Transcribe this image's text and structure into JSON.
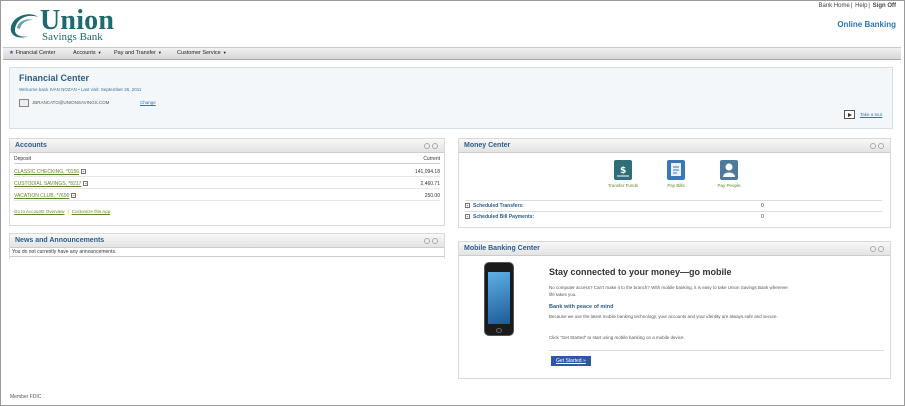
{
  "header": {
    "logo_main": "Union",
    "logo_sub": "Savings Bank",
    "top_links": [
      "Bank Home",
      "Help",
      "Sign Off"
    ],
    "online_banking": "Online Banking"
  },
  "nav": [
    {
      "label": "Financial Center",
      "caret": false
    },
    {
      "label": "Accounts",
      "caret": true
    },
    {
      "label": "Pay and Transfer",
      "caret": true
    },
    {
      "label": "Customer Service",
      "caret": true
    }
  ],
  "financial_center": {
    "title": "Financial Center",
    "welcome": "Welcome back IVAN NOZAN  •  Last visit: September 26, 2011",
    "email": "JBRANCATO@UNIONSAVINGS.COM",
    "change": "Change",
    "tour": "Take a tour"
  },
  "accounts": {
    "title": "Accounts",
    "col_left": "Deposit",
    "col_right": "Current",
    "rows": [
      {
        "name": "CLASSIC CHECKING, *0156",
        "balance": "141,094.18"
      },
      {
        "name": "CUSTODIAL SAVINGS, *8217",
        "balance": "2,460.71"
      },
      {
        "name": "VACATION CLUB, *7690",
        "balance": "250.00"
      }
    ],
    "link_overview": "Go to Accounts Overview",
    "link_customize": "Customize this App"
  },
  "news": {
    "title": "News and Announcements",
    "message": "You do not currently have any announcements."
  },
  "money_center": {
    "title": "Money Center",
    "tiles": [
      {
        "label": "Transfer Funds",
        "icon": "transfer-funds-icon",
        "color": "#2f6e78"
      },
      {
        "label": "Pay Bills",
        "icon": "pay-bills-icon",
        "color": "#3a78b5"
      },
      {
        "label": "Pay People",
        "icon": "pay-people-icon",
        "color": "#4d7a9b"
      }
    ],
    "scheduled_transfers_label": "Scheduled Transfers:",
    "scheduled_transfers_value": "0",
    "scheduled_bill_label": "Scheduled Bill Payments:",
    "scheduled_bill_value": "0"
  },
  "mobile": {
    "title": "Mobile Banking Center",
    "headline": "Stay connected to your money—go mobile",
    "intro": "No computer access? Can't make it to the branch? With mobile banking, it is easy to take Union Savings Bank wherever life takes you.",
    "sub": "Bank with peace of mind",
    "body": "Because we use the latest mobile banking technology, your accounts and your identity are always safe and secure.",
    "cta_text": "Click \"Get Started\" to start using mobile banking on a mobile device.",
    "button": "Get Started »"
  },
  "footer": "Member FDIC",
  "colors": {
    "brand": "#1d6b6e",
    "link": "#2a78b4",
    "title": "#2c5c8a",
    "account_link": "#5b8a2a"
  }
}
